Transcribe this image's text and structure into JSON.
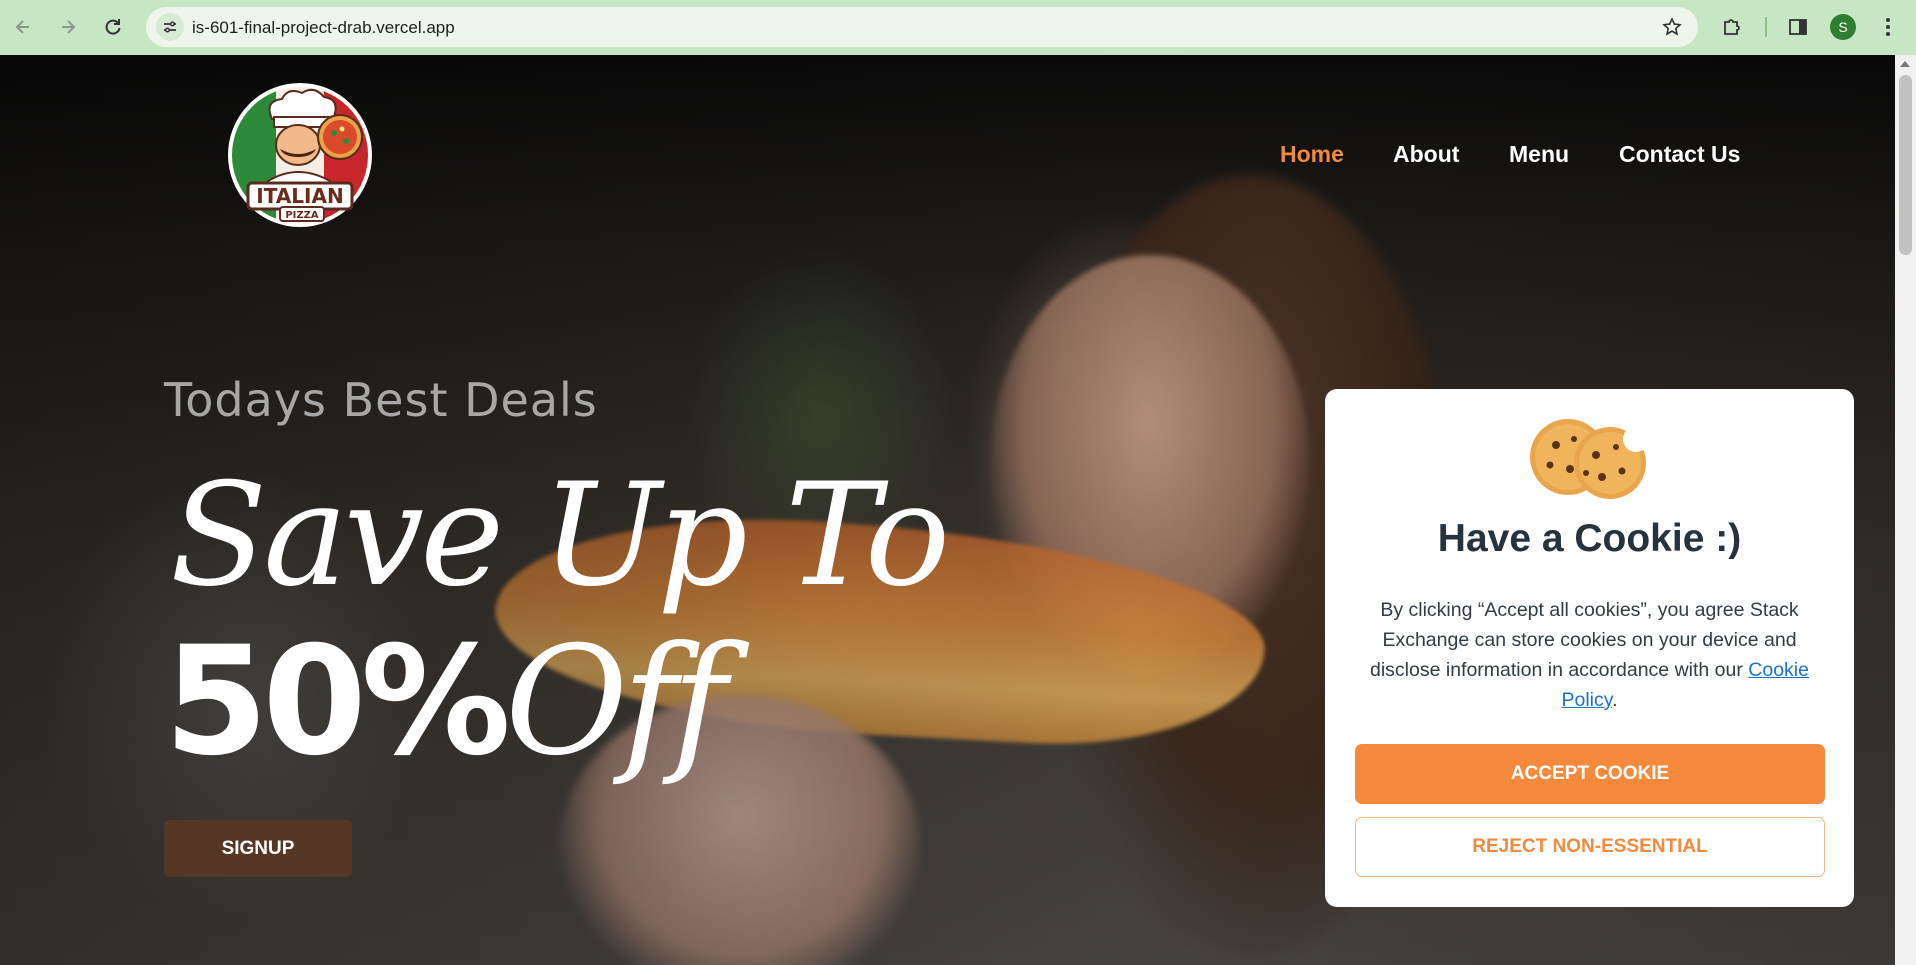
{
  "browser": {
    "url": "is-601-final-project-drab.vercel.app",
    "profile_initial": "S"
  },
  "nav": {
    "items": [
      {
        "label": "Home",
        "active": true
      },
      {
        "label": "About",
        "active": false
      },
      {
        "label": "Menu",
        "active": false
      },
      {
        "label": "Contact Us",
        "active": false
      }
    ]
  },
  "logo": {
    "text_main": "ITALIAN",
    "text_sub": "PIZZA"
  },
  "hero": {
    "kicker": "Todays Best Deals",
    "line1": "Save Up To",
    "line2_bold": "50%",
    "line2_italic": "Off",
    "signup_label": "SIGNUP"
  },
  "cookie": {
    "title": "Have a Cookie :)",
    "text_before": "By clicking “Accept all cookies”, you agree Stack Exchange can store cookies on your device and disclose information in accordance with our ",
    "link_text": "Cookie Policy",
    "text_after": ".",
    "accept_label": "ACCEPT COOKIE",
    "reject_label": "REJECT NON-ESSENTIAL"
  },
  "colors": {
    "accent": "#f58a3d",
    "nav_active": "#f08a3e",
    "signup_bg": "#553726",
    "browser_chrome": "#c7e6c4"
  }
}
